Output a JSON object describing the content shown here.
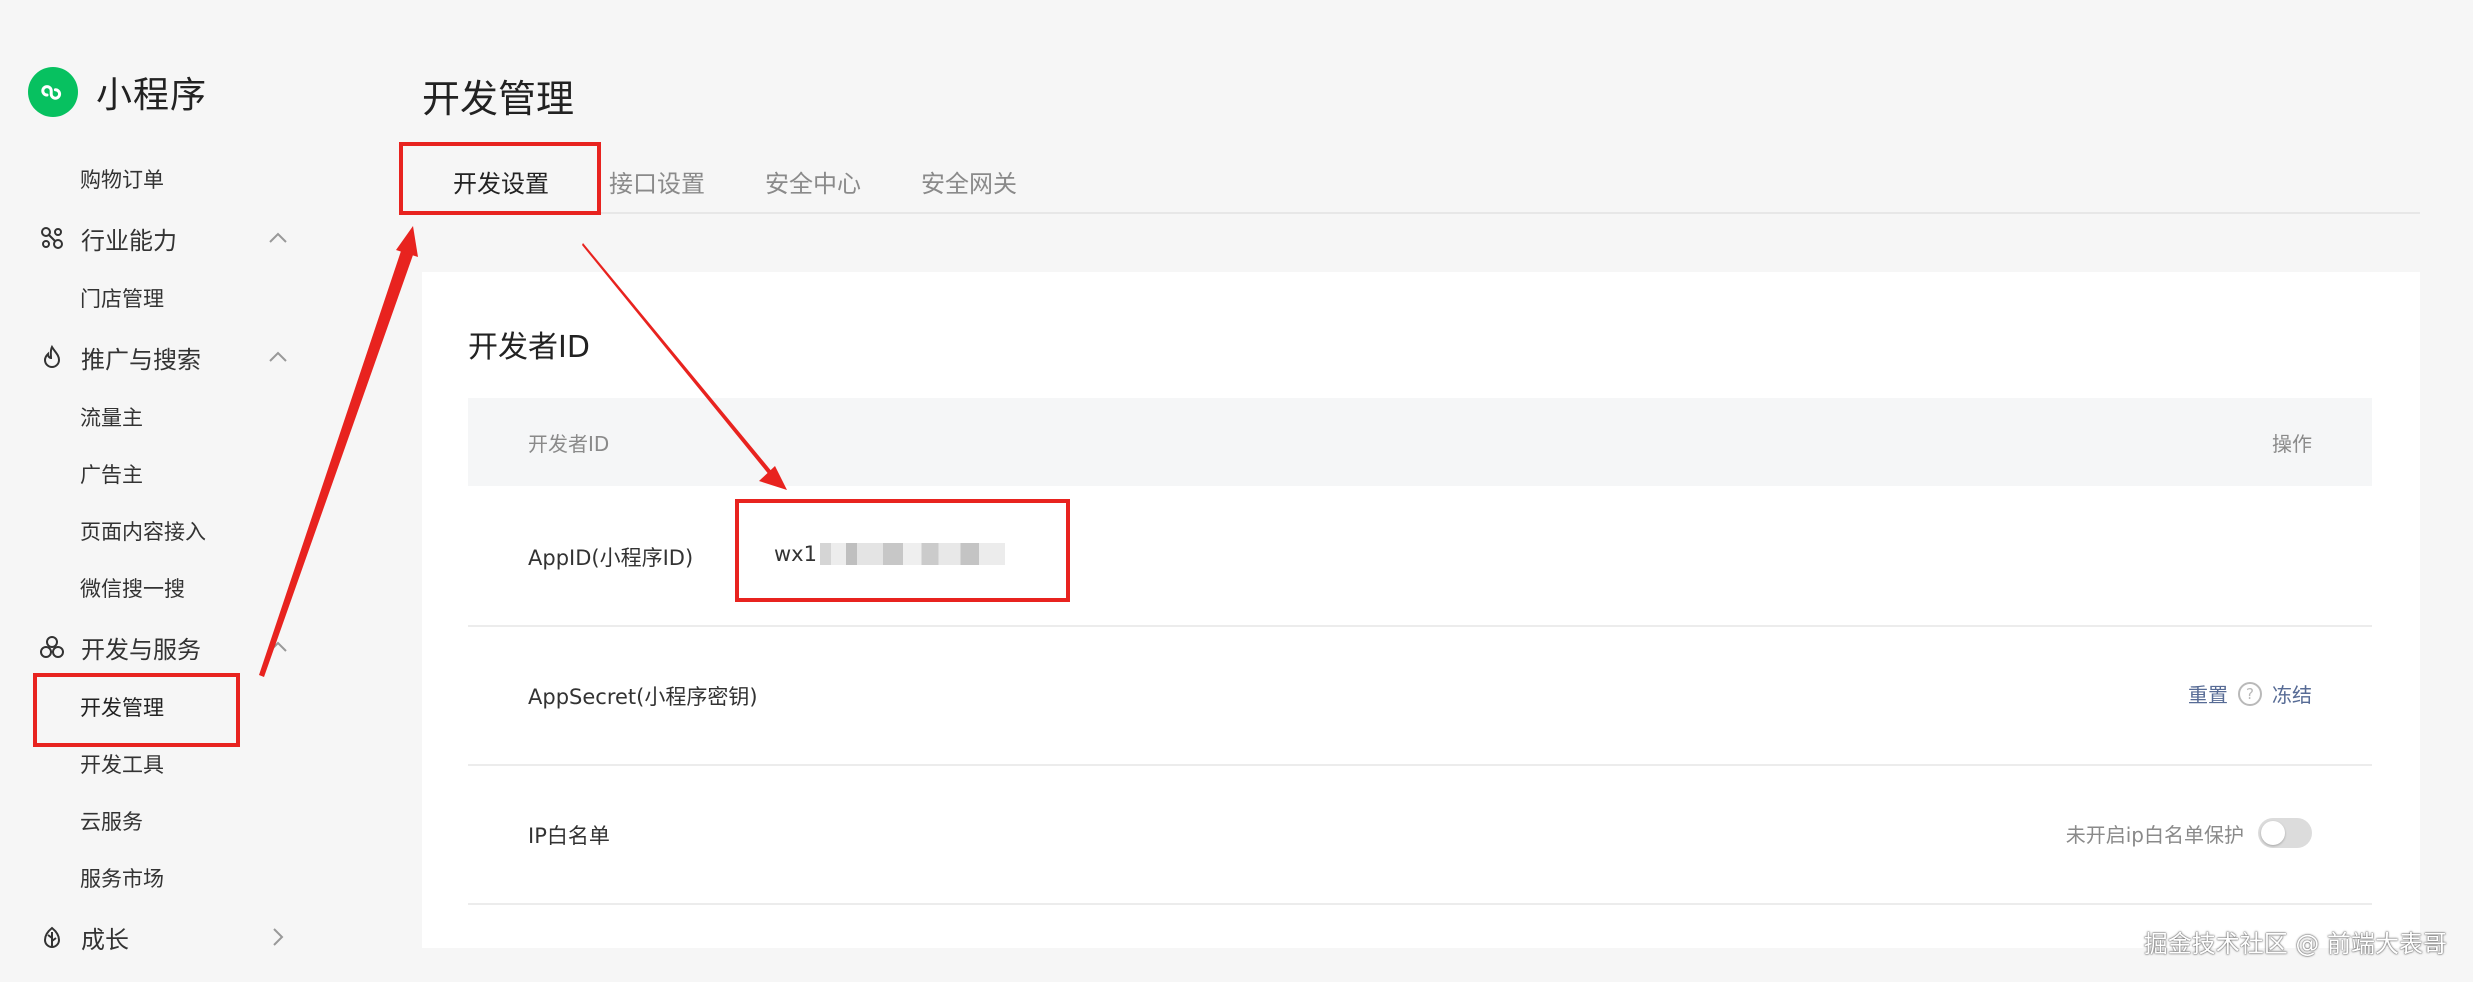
{
  "app": {
    "name": "小程序",
    "logo_icon": "mini-program-logo-icon",
    "brand_color": "#07c160"
  },
  "sidebar": {
    "items": [
      {
        "type": "item",
        "label": "购物订单"
      },
      {
        "type": "section",
        "label": "行业能力",
        "icon": "industry-icon",
        "chevron": "up"
      },
      {
        "type": "item",
        "label": "门店管理"
      },
      {
        "type": "section",
        "label": "推广与搜索",
        "icon": "flame-icon",
        "chevron": "up"
      },
      {
        "type": "item",
        "label": "流量主"
      },
      {
        "type": "item",
        "label": "广告主"
      },
      {
        "type": "item",
        "label": "页面内容接入"
      },
      {
        "type": "item",
        "label": "微信搜一搜"
      },
      {
        "type": "section",
        "label": "开发与服务",
        "icon": "cluster-icon",
        "chevron": "up"
      },
      {
        "type": "item",
        "label": "开发管理",
        "active": true
      },
      {
        "type": "item",
        "label": "开发工具"
      },
      {
        "type": "item",
        "label": "云服务"
      },
      {
        "type": "item",
        "label": "服务市场"
      },
      {
        "type": "section",
        "label": "成长",
        "icon": "growth-icon",
        "chevron": "right"
      }
    ]
  },
  "main": {
    "title": "开发管理",
    "tabs": [
      {
        "label": "开发设置",
        "active": true
      },
      {
        "label": "接口设置"
      },
      {
        "label": "安全中心"
      },
      {
        "label": "安全网关"
      }
    ],
    "card": {
      "title": "开发者ID",
      "columns": {
        "name": "开发者ID",
        "ops": "操作"
      },
      "rows": {
        "appid": {
          "label": "AppID(小程序ID)",
          "value_prefix": "wx1"
        },
        "secret": {
          "label": "AppSecret(小程序密钥)",
          "reset": "重置",
          "help": "?",
          "freeze": "冻结"
        },
        "ip": {
          "label": "IP白名单",
          "toggle_text": "未开启ip白名单保护",
          "toggle_on": false
        }
      }
    }
  },
  "watermark": "掘金技术社区 @ 前端大表哥",
  "colors": {
    "link": "#576b95",
    "annotation": "#e8231f"
  }
}
